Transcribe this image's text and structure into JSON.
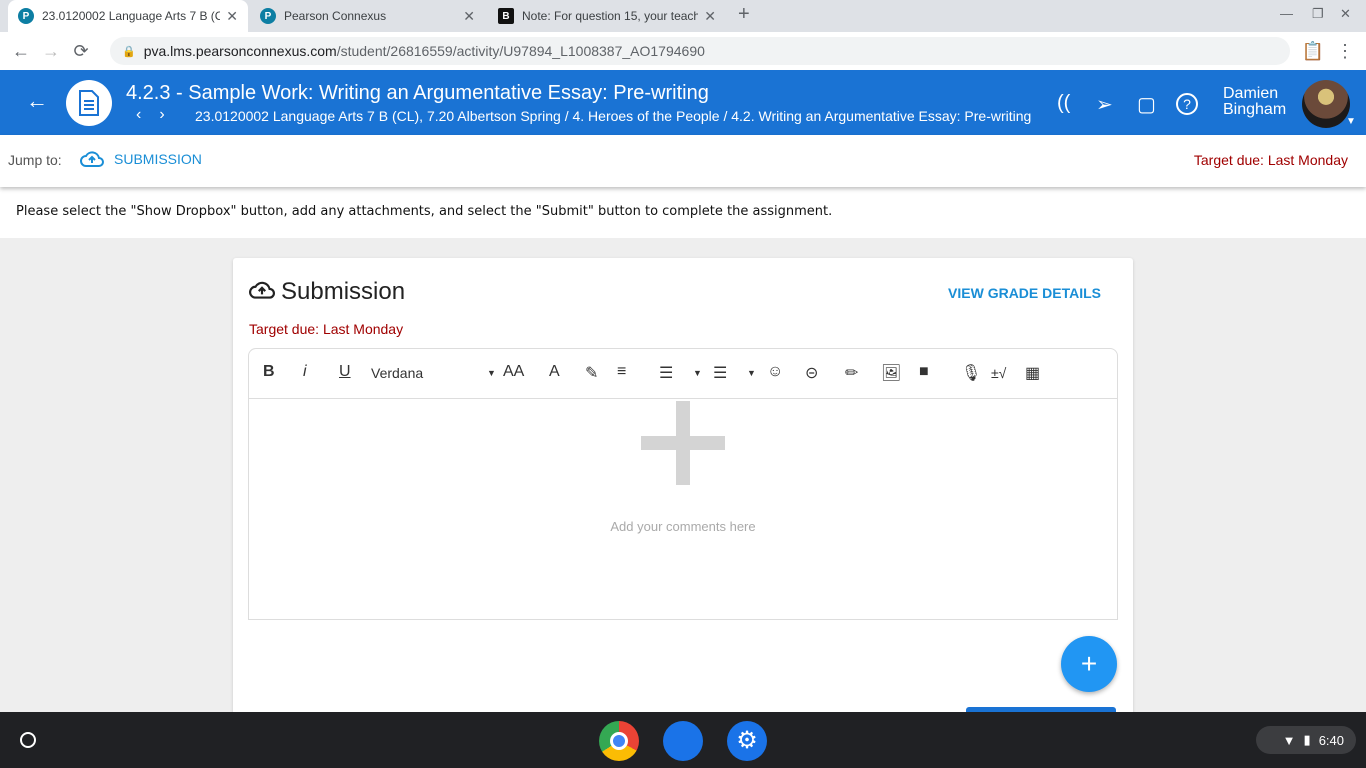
{
  "browser": {
    "tabs": [
      {
        "title": "23.0120002 Language Arts 7 B (CL)",
        "icon": "pearson-icon",
        "active": true
      },
      {
        "title": "Pearson Connexus",
        "icon": "pearson-icon",
        "active": false
      },
      {
        "title": "Note: For question 15, your teacher",
        "icon": "brainly-icon",
        "active": false
      }
    ],
    "url_host": "pva.lms.pearsonconnexus.com",
    "url_path": "/student/26816559/activity/U97894_L1008387_AO1794690"
  },
  "header": {
    "title": "4.2.3 - Sample Work: Writing an Argumentative Essay: Pre-writing",
    "breadcrumb": "23.0120002 Language Arts 7 B (CL), 7.20 Albertson Spring / 4. Heroes of the People / 4.2. Writing an Argumentative Essay: Pre-writing",
    "user_first": "Damien",
    "user_last": "Bingham",
    "accent": "#1a73d4"
  },
  "jump": {
    "label": "Jump to:",
    "submission": "SUBMISSION",
    "due": "Target due: Last Monday"
  },
  "instructions": "Please select the \"Show Dropbox\" button, add any attachments, and select the \"Submit\" button to complete the assignment.",
  "card": {
    "title": "Submission",
    "view_grade": "VIEW GRADE DETAILS",
    "due": "Target due: Last Monday",
    "toolbar": {
      "bold": "B",
      "italic": "i",
      "underline": "U",
      "font": "Verdana",
      "size": "AA",
      "math": "±√"
    },
    "placeholder": "Add your comments here"
  },
  "fab": "+",
  "taskbar": {
    "time": "6:40"
  }
}
